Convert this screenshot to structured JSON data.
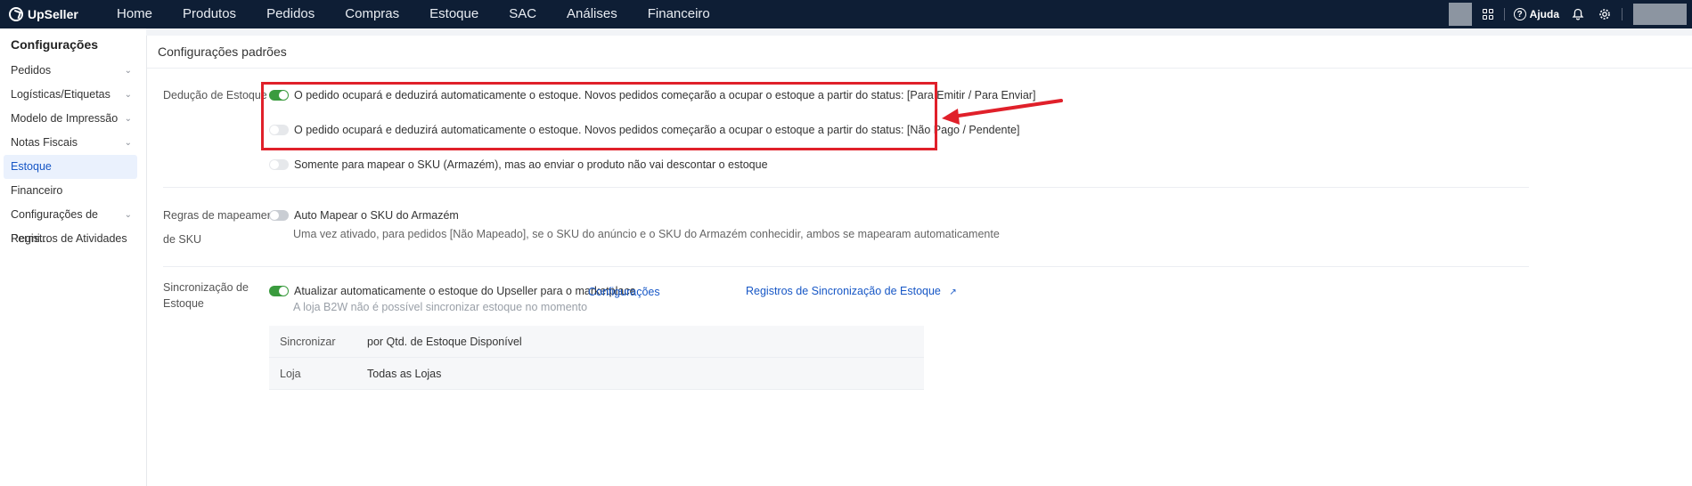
{
  "brand": {
    "name": "UpSeller"
  },
  "nav": [
    "Home",
    "Produtos",
    "Pedidos",
    "Compras",
    "Estoque",
    "SAC",
    "Análises",
    "Financeiro"
  ],
  "topright": {
    "help_label": "Ajuda"
  },
  "sidebar": {
    "title": "Configurações",
    "items": [
      {
        "label": "Pedidos",
        "expandable": true
      },
      {
        "label": "Logísticas/Etiquetas",
        "expandable": true
      },
      {
        "label": "Modelo de Impressão",
        "expandable": true
      },
      {
        "label": "Notas Fiscais",
        "expandable": true
      },
      {
        "label": "Estoque",
        "expandable": false,
        "active": true
      },
      {
        "label": "Financeiro",
        "expandable": false
      },
      {
        "label": "Configurações de Permi...",
        "expandable": true
      },
      {
        "label": "Registros de Atividades",
        "expandable": false
      }
    ]
  },
  "panel": {
    "title": "Configurações padrões",
    "deducao": {
      "label": "Dedução de Estoque",
      "options": [
        {
          "text": "O pedido ocupará e deduzirá automaticamente o estoque. Novos pedidos começarão a ocupar o estoque a partir do status: [Para Emitir / Para Enviar]",
          "on": true
        },
        {
          "text": "O pedido ocupará e deduzirá automaticamente o estoque. Novos pedidos começarão a ocupar o estoque a partir do status: [Não Pago / Pendente]",
          "on": false
        },
        {
          "text": "Somente para mapear o SKU (Armazém), mas ao enviar o produto não vai descontar o estoque",
          "on": false
        }
      ]
    },
    "regras": {
      "label_line1": "Regras de mapeamento",
      "label_line2": "de SKU",
      "option": "Auto Mapear o SKU do Armazém",
      "option_on": false,
      "hint": "Uma vez ativado, para pedidos [Não Mapeado], se o SKU do anúncio e o SKU do Armazém conhecidir, ambos se mapearam automaticamente"
    },
    "sinc": {
      "label_line1": "Sincronização de",
      "label_line2": "Estoque",
      "option": "Atualizar automaticamente o estoque do Upseller para o marketplace",
      "option_on": true,
      "config_link": "Configurações",
      "log_link": "Registros de Sincronização de Estoque",
      "hint": "A loja B2W não é possível sincronizar estoque no momento",
      "table": [
        {
          "key": "Sincronizar",
          "value": "por Qtd. de Estoque Disponível"
        },
        {
          "key": "Loja",
          "value": "Todas as Lojas"
        }
      ]
    }
  },
  "colors": {
    "topbar": "#0e1e35",
    "toggle_on": "#3a9b3e",
    "link": "#1757c6",
    "annotation": "#e0202a"
  }
}
